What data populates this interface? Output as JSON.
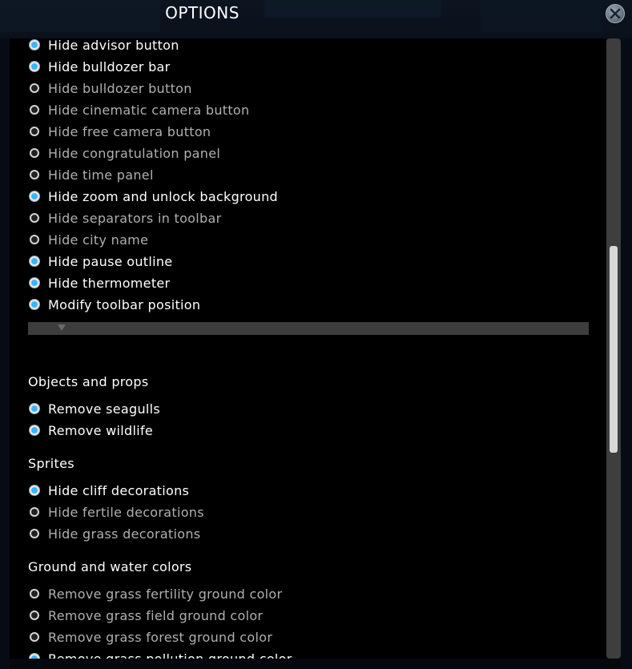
{
  "window": {
    "title": "OPTIONS"
  },
  "toolbar_options": [
    {
      "label": "Hide advisor button",
      "checked": true
    },
    {
      "label": "Hide bulldozer bar",
      "checked": true
    },
    {
      "label": "Hide bulldozer button",
      "checked": false
    },
    {
      "label": "Hide cinematic camera button",
      "checked": false
    },
    {
      "label": "Hide free camera button",
      "checked": false
    },
    {
      "label": "Hide congratulation panel",
      "checked": false
    },
    {
      "label": "Hide time panel",
      "checked": false
    },
    {
      "label": "Hide zoom and unlock background",
      "checked": true
    },
    {
      "label": "Hide separators in toolbar",
      "checked": false
    },
    {
      "label": "Hide city name",
      "checked": false
    },
    {
      "label": "Hide pause outline",
      "checked": true
    },
    {
      "label": "Hide thermometer",
      "checked": true
    },
    {
      "label": "Modify toolbar position",
      "checked": true
    }
  ],
  "objects": {
    "heading": "Objects and props",
    "items": [
      {
        "label": "Remove seagulls",
        "checked": true
      },
      {
        "label": "Remove wildlife",
        "checked": true
      }
    ]
  },
  "sprites": {
    "heading": "Sprites",
    "items": [
      {
        "label": "Hide cliff decorations",
        "checked": true
      },
      {
        "label": "Hide fertile decorations",
        "checked": false
      },
      {
        "label": "Hide grass decorations",
        "checked": false
      }
    ]
  },
  "ground": {
    "heading": "Ground and water colors",
    "items": [
      {
        "label": "Remove grass fertility ground color",
        "checked": false
      },
      {
        "label": "Remove grass field ground color",
        "checked": false
      },
      {
        "label": "Remove grass forest ground color",
        "checked": false
      },
      {
        "label": "Remove grass pollution ground color",
        "checked": true
      }
    ]
  },
  "colors": {
    "accent": "#3cb4ff",
    "checked_text": "#ffffff",
    "unchecked_text": "#b0b0b0"
  },
  "icons": {
    "close": "close-icon",
    "dropdown": "chevron-down-icon"
  }
}
